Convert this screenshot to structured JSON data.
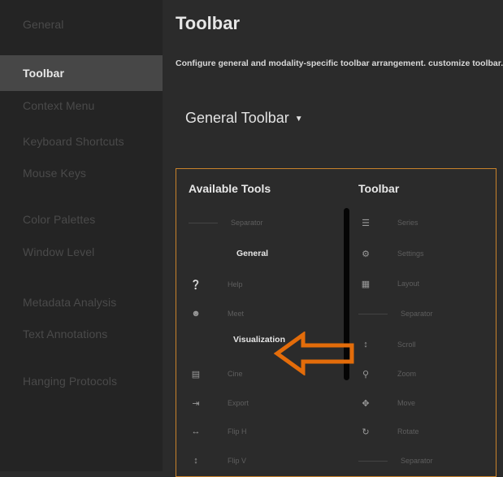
{
  "sidebar": {
    "items": [
      {
        "label": "General"
      },
      {
        "label": "Toolbar"
      },
      {
        "label": "Context Menu"
      },
      {
        "label": "Keyboard Shortcuts"
      },
      {
        "label": "Mouse Keys"
      },
      {
        "label": "Color Palettes"
      },
      {
        "label": "Window Level"
      },
      {
        "label": "Metadata Analysis"
      },
      {
        "label": "Text Annotations"
      },
      {
        "label": "Hanging Protocols"
      }
    ],
    "active": "Toolbar"
  },
  "main": {
    "title": "Toolbar",
    "description": "Configure general and modality-specific toolbar arrangement. customize toolbar.",
    "dropdown": "General Toolbar"
  },
  "available_tools": {
    "header": "Available Tools",
    "separator": "Separator",
    "section_general": "General",
    "help": "Help",
    "meet": "Meet",
    "section_visualization": "Visualization",
    "cine": "Cine",
    "export": "Export",
    "flip_h": "Flip H",
    "flip_v": "Flip V"
  },
  "toolbar": {
    "header": "Toolbar",
    "series": "Series",
    "settings": "Settings",
    "layout": "Layout",
    "separator": "Separator",
    "scroll": "Scroll",
    "zoom": "Zoom",
    "move": "Move",
    "rotate": "Rotate",
    "separator2": "Separator"
  },
  "colors": {
    "accent_border": "#c8822b",
    "arrow_stroke": "#e36c0a",
    "sidebar_active": "#474747"
  }
}
